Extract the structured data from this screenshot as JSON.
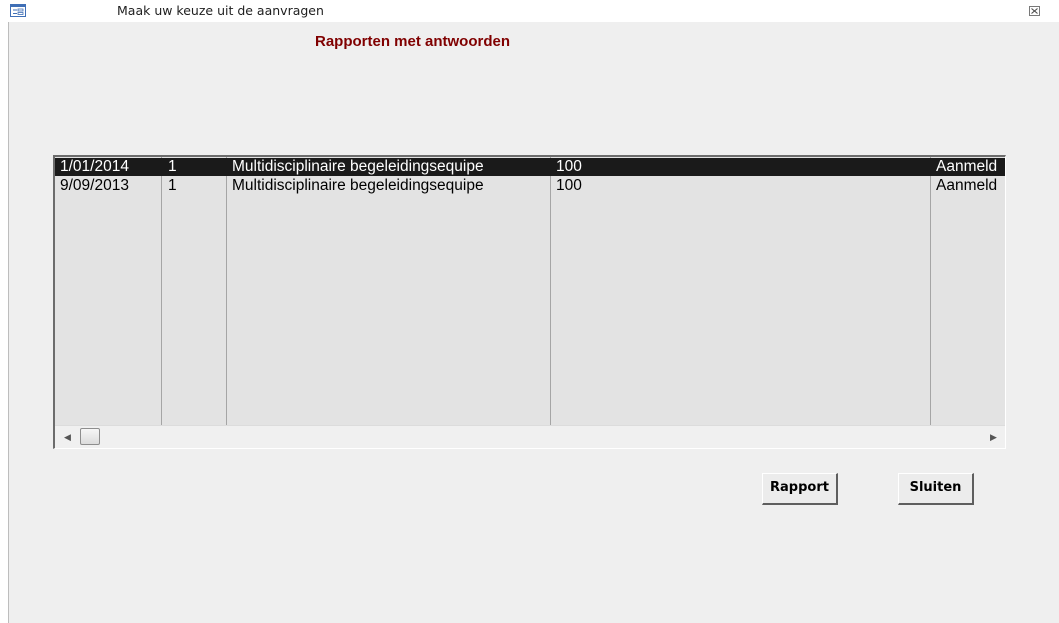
{
  "window": {
    "title": "Maak uw keuze uit de aanvragen"
  },
  "form": {
    "heading": "Rapporten met antwoorden"
  },
  "listbox": {
    "rows": [
      {
        "c1": "1/01/2014",
        "c2": "1",
        "c3": "Multidisciplinaire begeleidingsequipe",
        "c4": "100",
        "c5": "Aanmeld",
        "selected": true
      },
      {
        "c1": "9/09/2013",
        "c2": "1",
        "c3": "Multidisciplinaire begeleidingsequipe",
        "c4": "100",
        "c5": "Aanmeld",
        "selected": false
      }
    ]
  },
  "buttons": {
    "rapport": "Rapport",
    "sluiten": "Sluiten"
  },
  "icons": {
    "form": "form-icon",
    "close": "close-icon",
    "scroll_left": "arrow-left-icon",
    "scroll_right": "arrow-right-icon"
  },
  "colors": {
    "heading": "#800000",
    "selection": "#1a1a1a"
  }
}
